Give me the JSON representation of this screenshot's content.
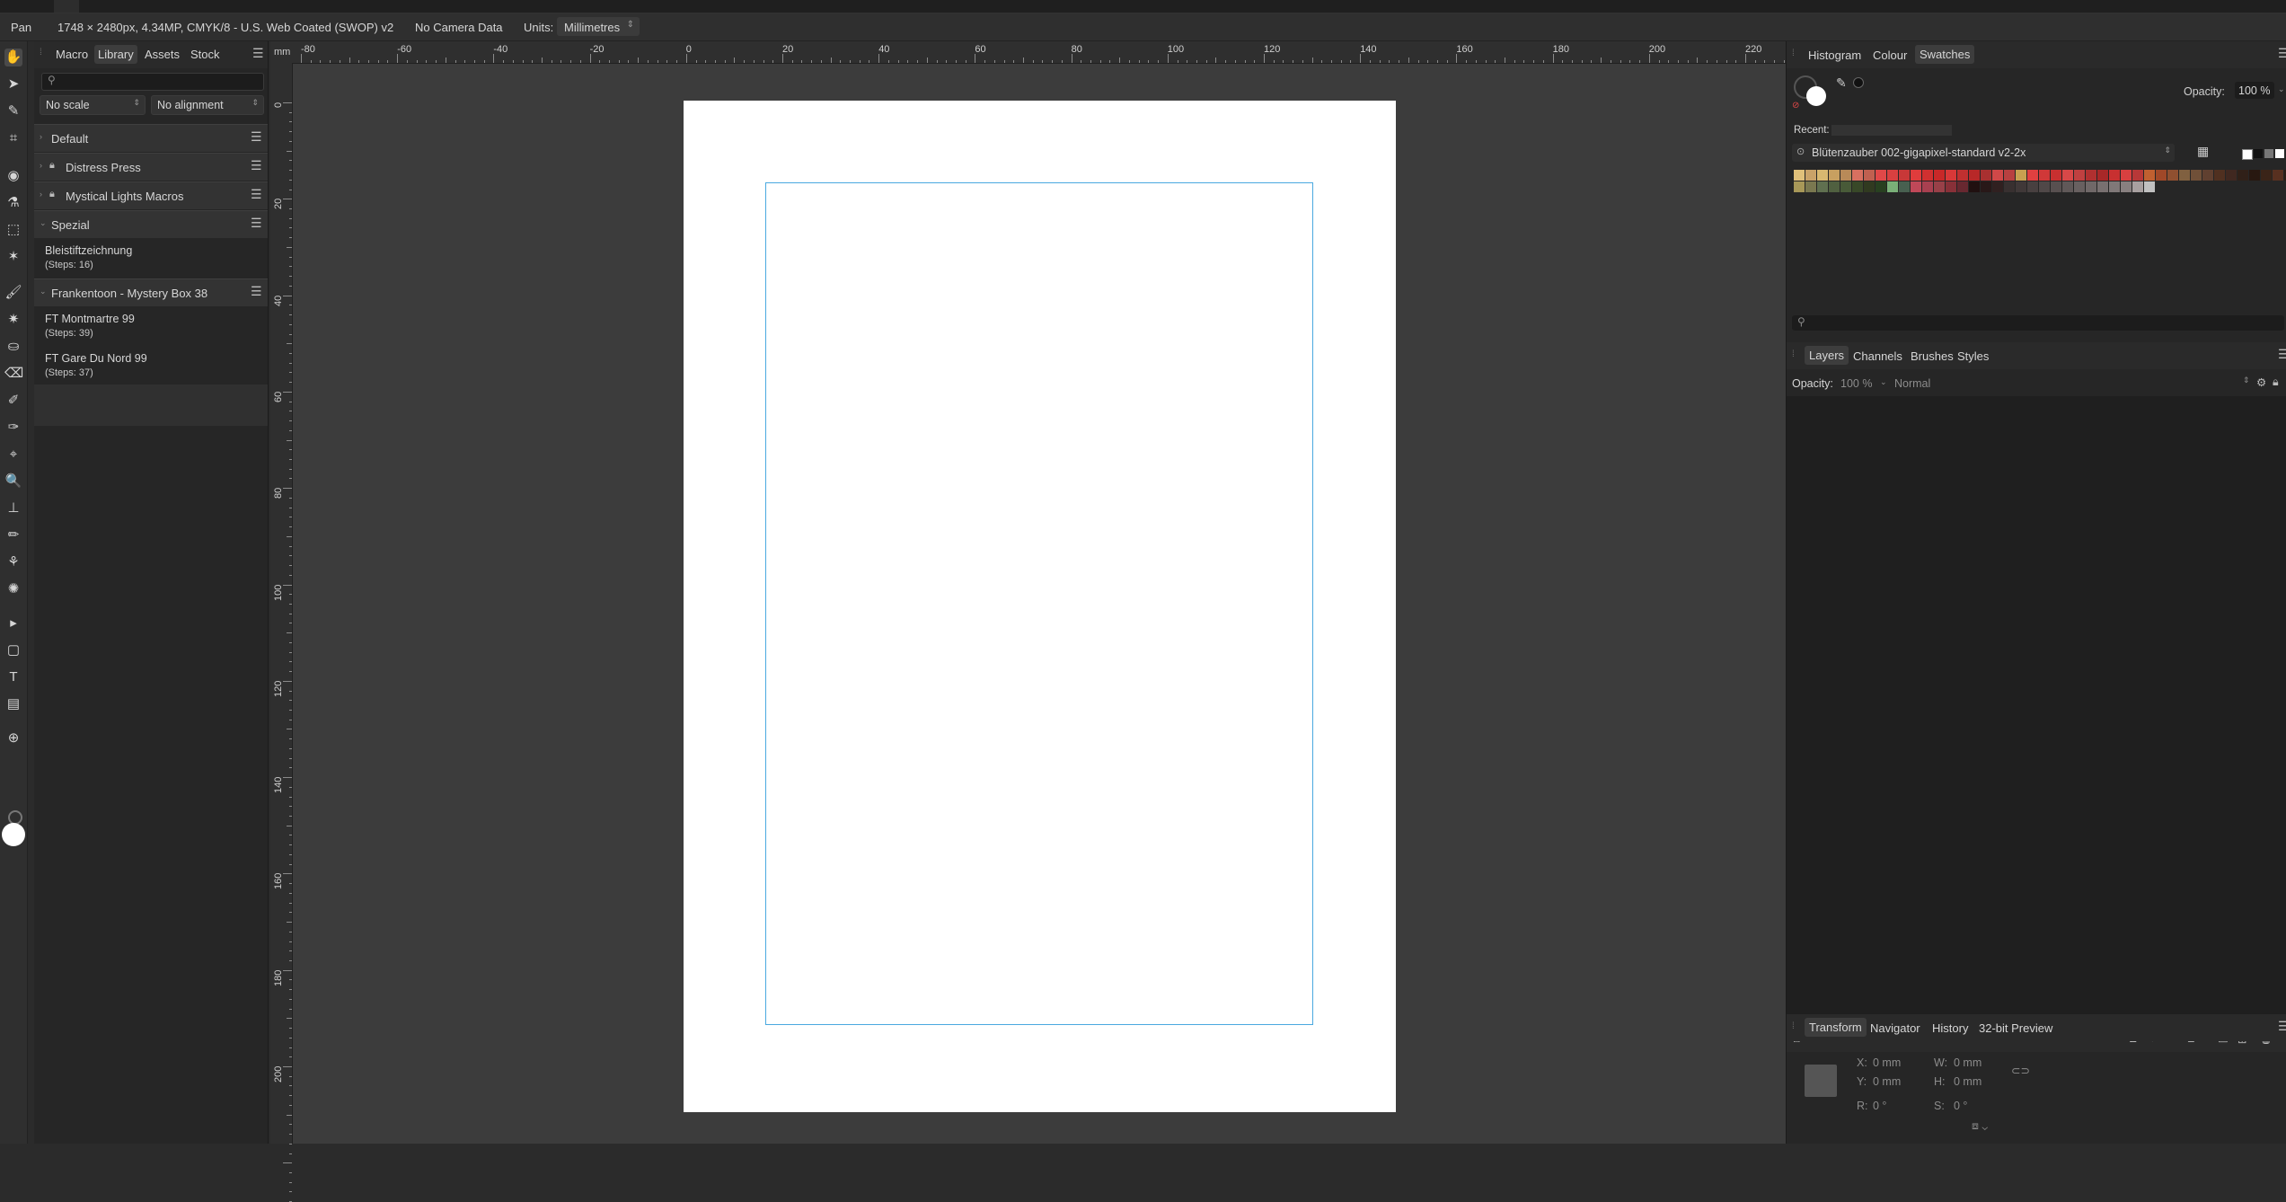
{
  "context_bar": {
    "tool": "Pan",
    "doc_info": "1748 × 2480px, 4.34MP, CMYK/8 - U.S. Web Coated (SWOP) v2",
    "camera": "No Camera Data",
    "units_label": "Units:",
    "units_value": "Millimetres"
  },
  "left_panel": {
    "tabs": [
      "Macro",
      "Library",
      "Assets",
      "Stock"
    ],
    "active_tab": "Library",
    "scale_option": "No scale",
    "alignment_option": "No alignment",
    "categories": [
      {
        "name": "Default",
        "locked": false,
        "expanded": false,
        "macros": []
      },
      {
        "name": "Distress Press",
        "locked": true,
        "expanded": false,
        "macros": []
      },
      {
        "name": "Mystical Lights Macros",
        "locked": true,
        "expanded": false,
        "macros": []
      },
      {
        "name": "Spezial",
        "locked": false,
        "expanded": true,
        "macros": [
          {
            "name": "Bleistiftzeichnung",
            "steps": "(Steps: 16)"
          }
        ]
      },
      {
        "name": "Frankentoon - Mystery Box 38",
        "locked": false,
        "expanded": true,
        "macros": [
          {
            "name": "FT Montmartre 99",
            "steps": "(Steps: 39)"
          },
          {
            "name": "FT Gare Du Nord 99",
            "steps": "(Steps: 37)"
          }
        ]
      }
    ]
  },
  "rulers": {
    "unit": "mm",
    "top_ticks": [
      "-80",
      "-60",
      "-40",
      "-20",
      "0",
      "20",
      "40",
      "60",
      "80",
      "100",
      "120",
      "140",
      "160",
      "180",
      "200",
      "220"
    ],
    "left_ticks": [
      "0",
      "20",
      "40",
      "60",
      "80",
      "100",
      "120",
      "140",
      "160",
      "180",
      "200"
    ]
  },
  "swatches_panel": {
    "tabs": [
      "Histogram",
      "Colour",
      "Swatches"
    ],
    "active_tab": "Swatches",
    "opacity_label": "Opacity:",
    "opacity_value": "100 %",
    "recent_label": "Recent:",
    "palette_name": "Blütenzauber 002-gigapixel-standard v2-2x",
    "row1": [
      "#e0c07a",
      "#c9a268",
      "#d8b870",
      "#c8a060",
      "#b88a58",
      "#d87060",
      "#c06050",
      "#e04848",
      "#d84040",
      "#c83838",
      "#e03c3c",
      "#d03030",
      "#c82828",
      "#d83838",
      "#c03030",
      "#b82828",
      "#a83030",
      "#d04848",
      "#b84040",
      "#c8a050",
      "#e04040",
      "#d03838",
      "#c83030",
      "#d84848",
      "#c04040",
      "#b03030",
      "#a82828",
      "#c83030",
      "#d84040",
      "#b83838",
      "#c06030",
      "#a04828",
      "#905030",
      "#806040",
      "#705038",
      "#604030",
      "#503020",
      "#402820",
      "#302018",
      "#281810",
      "#3a2418",
      "#583020",
      "#2c1c14",
      "#6a8a40",
      "#1a1a1a"
    ],
    "row2": [
      "#a89858",
      "#7a7850",
      "#607050",
      "#506040",
      "#485a38",
      "#384828",
      "#303a20",
      "#284020",
      "#7ab078",
      "#486050",
      "#c04858",
      "#a84050",
      "#984048",
      "#883038",
      "#682830",
      "#201010",
      "#281818",
      "#302020",
      "#383030",
      "#403838",
      "#484040",
      "#504848",
      "#585050",
      "#605858",
      "#686060",
      "#706868",
      "#787070",
      "#807878",
      "#888080",
      "#a8a0a0",
      "#c0c0c0"
    ]
  },
  "layers_panel": {
    "tabs": [
      "Layers",
      "Channels",
      "Brushes",
      "Styles"
    ],
    "active_tab": "Layers",
    "opacity_label": "Opacity:",
    "opacity_value": "100 %",
    "blend_mode": "Normal"
  },
  "transform_panel": {
    "tabs": [
      "Transform",
      "Navigator",
      "History",
      "32-bit Preview"
    ],
    "active_tab": "Transform",
    "fields": {
      "x_label": "X:",
      "x_value": "0 mm",
      "y_label": "Y:",
      "y_value": "0 mm",
      "w_label": "W:",
      "w_value": "0 mm",
      "h_label": "H:",
      "h_value": "0 mm",
      "r_label": "R:",
      "r_value": "0 °",
      "s_label": "S:",
      "s_value": "0 °"
    }
  },
  "colors": {
    "accent_margin": "#4aa9e0",
    "page_white": "#ffffff",
    "canvas_bg": "#3c3c3c"
  }
}
